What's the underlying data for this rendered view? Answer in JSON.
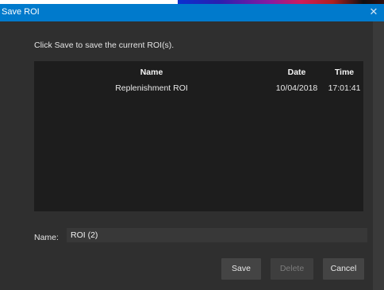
{
  "window": {
    "title": "Save ROI",
    "close_glyph": "✕"
  },
  "instruction": "Click Save to save the current ROI(s).",
  "table": {
    "columns": [
      "Name",
      "Date",
      "Time"
    ],
    "rows": [
      {
        "name": "Replenishment ROI",
        "date": "10/04/2018",
        "time": "17:01:41"
      }
    ]
  },
  "name_field": {
    "label": "Name:",
    "value": "ROI (2)"
  },
  "buttons": {
    "save": "Save",
    "delete": "Delete",
    "cancel": "Cancel"
  },
  "colors": {
    "titlebar": "#007acc",
    "background": "#2f2f2f",
    "table_bg": "#1d1d1d"
  }
}
